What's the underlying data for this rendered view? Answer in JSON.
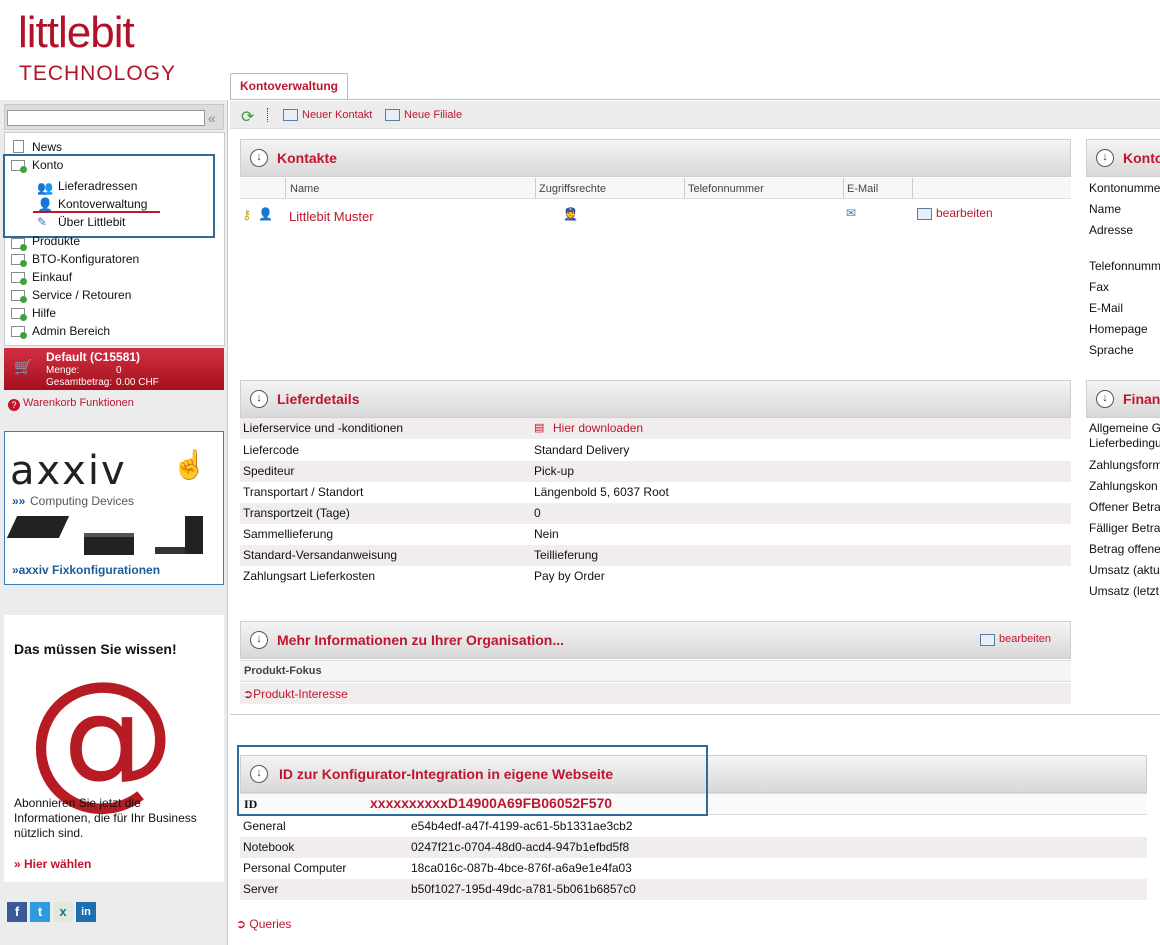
{
  "brand": {
    "name": "littlebit",
    "sub": "TECHNOLOGY"
  },
  "tab": {
    "label": "Kontoverwaltung"
  },
  "toolbar": {
    "new_contact": "Neuer Kontakt",
    "new_branch": "Neue Filiale"
  },
  "sidebar": {
    "collapse_glyph": "«",
    "items": [
      {
        "label": "News"
      },
      {
        "label": "Konto"
      },
      {
        "label": "Lieferadressen"
      },
      {
        "label": "Kontoverwaltung"
      },
      {
        "label": "Über Littlebit"
      },
      {
        "label": "Produkte"
      },
      {
        "label": "BTO-Konfiguratoren"
      },
      {
        "label": "Einkauf"
      },
      {
        "label": "Service / Retouren"
      },
      {
        "label": "Hilfe"
      },
      {
        "label": "Admin Bereich"
      }
    ],
    "cart": {
      "title": "Default (C15581)",
      "qty_label": "Menge:",
      "qty_value": "0",
      "total_label": "Gesamtbetrag:",
      "total_value": "0.00 CHF"
    },
    "cart_functions": "Warenkorb Funktionen",
    "ad1": {
      "brand": "axxiv",
      "tagline": "Computing Devices",
      "link": "»axxiv Fixkonfigurationen"
    },
    "ad2": {
      "title": "Das müssen Sie wissen!",
      "symbol": "@",
      "text": "Abonnieren Sie jetzt die Informationen, die für Ihr Business nützlich sind.",
      "link": "» Hier wählen"
    },
    "social": [
      "f",
      "t",
      "x",
      "in"
    ]
  },
  "contacts": {
    "title": "Kontakte",
    "headers": [
      "Name",
      "Zugriffsrechte",
      "Telefonnummer",
      "E-Mail"
    ],
    "rows": [
      {
        "name": "Littlebit Muster",
        "action": "bearbeiten"
      }
    ]
  },
  "account_panel": {
    "title": "Konto",
    "labels": [
      "Kontonumme",
      "Name",
      "Adresse",
      "Telefonnumm",
      "Fax",
      "E-Mail",
      "Homepage",
      "Sprache"
    ]
  },
  "delivery": {
    "title": "Lieferdetails",
    "rows": [
      {
        "label": "Lieferservice und -konditionen",
        "value": "Hier downloaden"
      },
      {
        "label": "Liefercode",
        "value": "Standard Delivery"
      },
      {
        "label": "Spediteur",
        "value": "Pick-up"
      },
      {
        "label": "Transportart / Standort",
        "value": "Längenbold 5, 6037 Root"
      },
      {
        "label": "Transportzeit (Tage)",
        "value": "0"
      },
      {
        "label": "Sammellieferung",
        "value": "Nein"
      },
      {
        "label": "Standard-Versandanweisung",
        "value": "Teillieferung"
      },
      {
        "label": "Zahlungsart Lieferkosten",
        "value": "Pay by Order"
      }
    ]
  },
  "finance_panel": {
    "title": "Finan",
    "labels": [
      "Allgemeine G",
      "Lieferbedingu",
      "Zahlungsform",
      "Zahlungskon",
      "Offener Betra",
      "Fälliger Betra",
      "Betrag offene",
      "Umsatz (aktu",
      "Umsatz (letzt"
    ]
  },
  "org": {
    "title": "Mehr Informationen zu Ihrer Organisation...",
    "action": "bearbeiten",
    "focus": "Produkt-Fokus",
    "interest": "Produkt-Interesse"
  },
  "integration": {
    "title": "ID zur Konfigurator-Integration in eigene Webseite",
    "id_label": "ID",
    "id_value": "xxxxxxxxxxD14900A69FB06052F570",
    "rows": [
      {
        "label": "General",
        "value": "e54b4edf-a47f-4199-ac61-5b1331ae3cb2"
      },
      {
        "label": "Notebook",
        "value": "0247f21c-0704-48d0-acd4-947b1efbd5f8"
      },
      {
        "label": "Personal Computer",
        "value": "18ca016c-087b-4bce-876f-a6a9e1e4fa03"
      },
      {
        "label": "Server",
        "value": "b50f1027-195d-49dc-a781-5b061b6857c0"
      }
    ],
    "queries": "Queries"
  },
  "colors": {
    "accent": "#c0152f",
    "highlight_border": "#2c6b9a",
    "panel_bg": "#ececec"
  }
}
